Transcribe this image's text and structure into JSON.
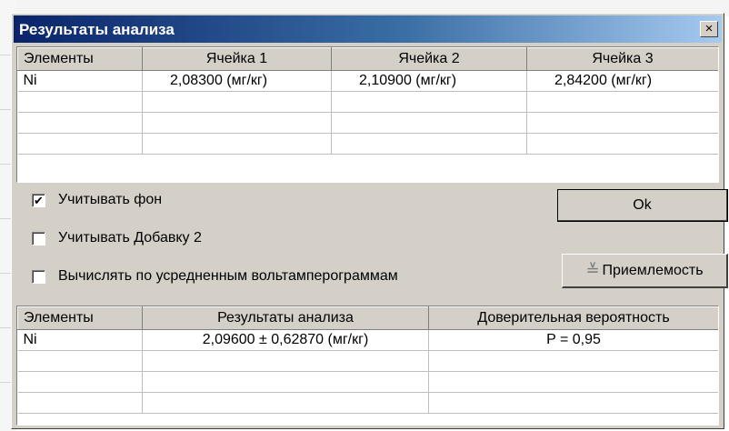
{
  "dialog": {
    "title": "Результаты анализа",
    "close_icon": "close-icon",
    "close_glyph": "×"
  },
  "cells_table": {
    "headers": [
      "Элементы",
      "Ячейка 1",
      "Ячейка 2",
      "Ячейка 3"
    ],
    "rows": [
      [
        "Ni",
        "2,08300  (мг/кг)",
        "2,10900  (мг/кг)",
        "2,84200  (мг/кг)"
      ],
      [
        "",
        "",
        "",
        ""
      ],
      [
        "",
        "",
        "",
        ""
      ],
      [
        "",
        "",
        "",
        ""
      ]
    ]
  },
  "options": {
    "background": {
      "label": "Учитывать фон",
      "checked": true,
      "mark": "✔"
    },
    "additive": {
      "label": "Учитывать Добавку 2",
      "checked": false
    },
    "averaged": {
      "label": "Вычислять по усредненным вольтамперограммам",
      "checked": false
    }
  },
  "buttons": {
    "ok_label": "Ok",
    "acceptability_label": "Приемлемость",
    "acceptability_icon": "double-chevron-down-icon",
    "acceptability_glyph": "≚"
  },
  "results_table": {
    "headers": [
      "Элементы",
      "Результаты анализа",
      "Доверительная вероятность"
    ],
    "rows": [
      [
        "Ni",
        "2,09600 ± 0,62870  (мг/кг)",
        "P = 0,95"
      ],
      [
        "",
        "",
        ""
      ],
      [
        "",
        "",
        ""
      ],
      [
        "",
        "",
        ""
      ]
    ]
  }
}
